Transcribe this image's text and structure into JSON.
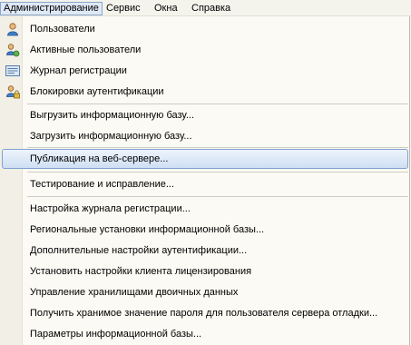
{
  "menubar": {
    "items": [
      {
        "label": "Администрирование",
        "active": true
      },
      {
        "label": "Сервис"
      },
      {
        "label": "Окна"
      },
      {
        "label": "Справка"
      }
    ]
  },
  "menu": {
    "items": [
      {
        "label": "Пользователи",
        "icon": "user-icon"
      },
      {
        "label": "Активные пользователи",
        "icon": "active-users-icon"
      },
      {
        "label": "Журнал регистрации",
        "icon": "log-icon"
      },
      {
        "label": "Блокировки аутентификации",
        "icon": "auth-lock-icon"
      },
      {
        "label": "Выгрузить информационную базу..."
      },
      {
        "label": "Загрузить информационную базу..."
      },
      {
        "label": "Публикация на веб-сервере...",
        "selected": true
      },
      {
        "label": "Тестирование и исправление..."
      },
      {
        "label": "Настройка журнала регистрации..."
      },
      {
        "label": "Региональные установки информационной базы..."
      },
      {
        "label": "Дополнительные настройки аутентификации..."
      },
      {
        "label": "Установить настройки клиента лицензирования"
      },
      {
        "label": "Управление хранилищами двоичных данных"
      },
      {
        "label": "Получить хранимое значение пароля для пользователя сервера отладки..."
      },
      {
        "label": "Параметры информационной базы..."
      }
    ]
  }
}
